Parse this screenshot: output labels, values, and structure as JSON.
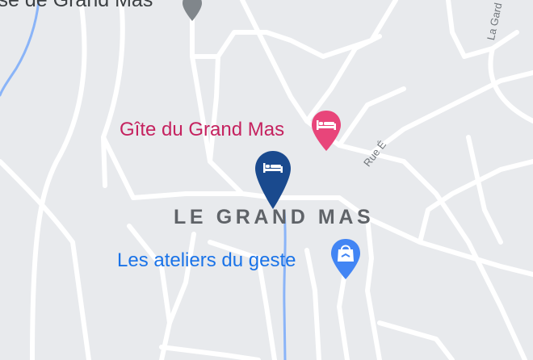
{
  "map": {
    "place_label_top": "ise de Grand Mas",
    "place_label_main": "LE GRAND MAS",
    "street_labels": {
      "rue": "Rue É",
      "garde": "La Gard"
    },
    "pois": [
      {
        "name": "Gîte du Grand Mas",
        "category": "lodging",
        "icon": "bed-icon",
        "color": "#e8457a"
      },
      {
        "name": "Les ateliers du geste",
        "category": "shopping",
        "icon": "shopping-bag-icon",
        "color": "#4285f4"
      }
    ],
    "selected_marker": {
      "icon": "bed-icon",
      "color": "#1a4a8e"
    },
    "colors": {
      "background": "#e8eaed",
      "road": "#ffffff",
      "water": "#8ab4f8"
    }
  }
}
